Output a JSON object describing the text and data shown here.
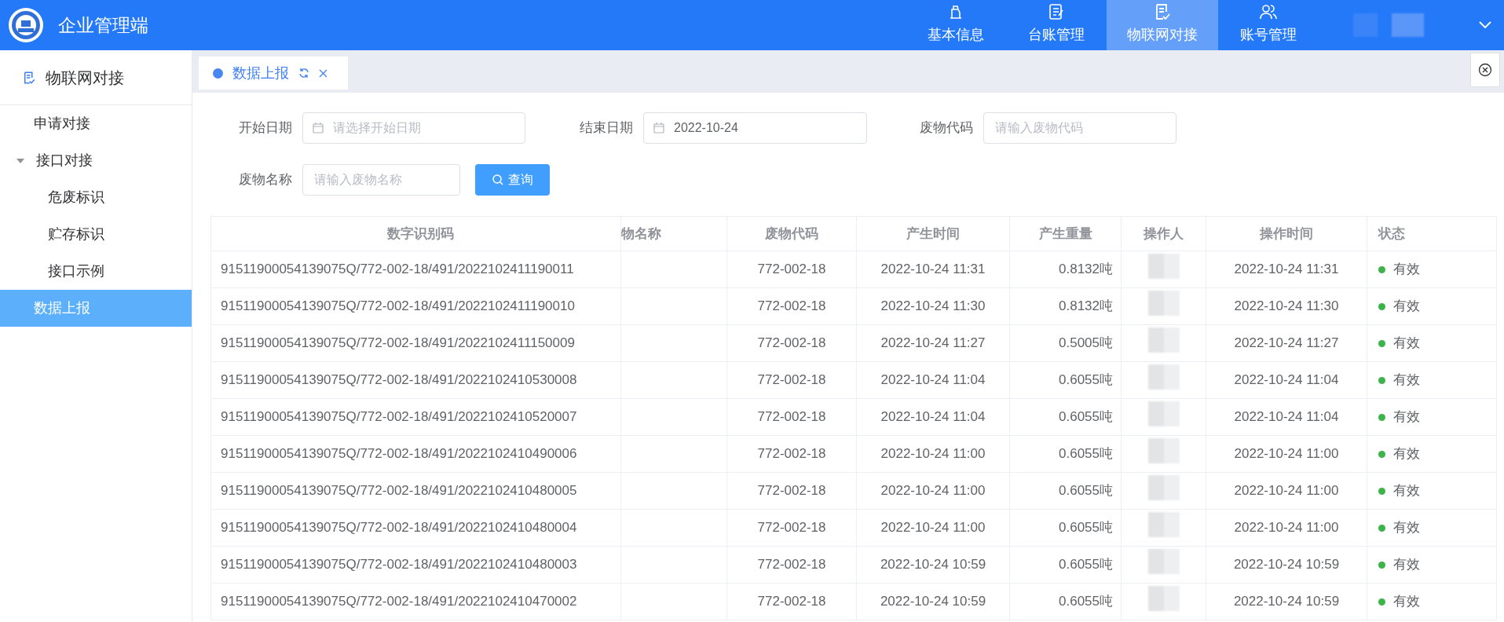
{
  "header": {
    "title": "企业管理端",
    "nav": [
      {
        "label": "基本信息",
        "selected": false
      },
      {
        "label": "台账管理",
        "selected": false
      },
      {
        "label": "物联网对接",
        "selected": true
      },
      {
        "label": "账号管理",
        "selected": false
      }
    ]
  },
  "sidebar": {
    "title": "物联网对接",
    "items": [
      {
        "label": "申请对接",
        "selected": false
      },
      {
        "label": "接口对接",
        "selected": false,
        "expanded": true,
        "children": [
          {
            "label": "危废标识",
            "selected": false
          },
          {
            "label": "贮存标识",
            "selected": false
          },
          {
            "label": "接口示例",
            "selected": false
          }
        ]
      },
      {
        "label": "数据上报",
        "selected": true
      }
    ]
  },
  "tabs": [
    {
      "label": "数据上报",
      "selected": true
    }
  ],
  "filters": [
    {
      "label": "开始日期",
      "kind": "date",
      "placeholder": "请选择开始日期"
    },
    {
      "label": "结束日期",
      "kind": "date",
      "value": "2022-10-24"
    },
    {
      "label": "废物代码",
      "kind": "text",
      "placeholder": "请输入废物代码"
    },
    {
      "label": "废物名称",
      "kind": "text",
      "placeholder": "请输入废物名称"
    }
  ],
  "search_button": "查询",
  "table": {
    "columns": [
      "数字识别码",
      "物名称",
      "废物代码",
      "产生时间",
      "产生重量",
      "操作人",
      "操作时间",
      "状态"
    ],
    "rows": [
      {
        "code": "91511900054139075Q/772-002-18/491/2022102411190011",
        "waste_code": "772-002-18",
        "time": "2022-10-24 11:31",
        "weight": "0.8132吨",
        "op_time": "2022-10-24 11:31",
        "status": "有效",
        "color": "#3cb44a"
      },
      {
        "code": "91511900054139075Q/772-002-18/491/2022102411190010",
        "waste_code": "772-002-18",
        "time": "2022-10-24 11:30",
        "weight": "0.8132吨",
        "op_time": "2022-10-24 11:30",
        "status": "有效",
        "color": "#3cb44a"
      },
      {
        "code": "91511900054139075Q/772-002-18/491/2022102411150009",
        "waste_code": "772-002-18",
        "time": "2022-10-24 11:27",
        "weight": "0.5005吨",
        "op_time": "2022-10-24 11:27",
        "status": "有效",
        "color": "#3cb44a"
      },
      {
        "code": "91511900054139075Q/772-002-18/491/2022102410530008",
        "waste_code": "772-002-18",
        "time": "2022-10-24 11:04",
        "weight": "0.6055吨",
        "op_time": "2022-10-24 11:04",
        "status": "有效",
        "color": "#3cb44a"
      },
      {
        "code": "91511900054139075Q/772-002-18/491/2022102410520007",
        "waste_code": "772-002-18",
        "time": "2022-10-24 11:04",
        "weight": "0.6055吨",
        "op_time": "2022-10-24 11:04",
        "status": "有效",
        "color": "#3cb44a"
      },
      {
        "code": "91511900054139075Q/772-002-18/491/2022102410490006",
        "waste_code": "772-002-18",
        "time": "2022-10-24 11:00",
        "weight": "0.6055吨",
        "op_time": "2022-10-24 11:00",
        "status": "有效",
        "color": "#3cb44a"
      },
      {
        "code": "91511900054139075Q/772-002-18/491/2022102410480005",
        "waste_code": "772-002-18",
        "time": "2022-10-24 11:00",
        "weight": "0.6055吨",
        "op_time": "2022-10-24 11:00",
        "status": "有效",
        "color": "#3cb44a"
      },
      {
        "code": "91511900054139075Q/772-002-18/491/2022102410480004",
        "waste_code": "772-002-18",
        "time": "2022-10-24 11:00",
        "weight": "0.6055吨",
        "op_time": "2022-10-24 11:00",
        "status": "有效",
        "color": "#3cb44a"
      },
      {
        "code": "91511900054139075Q/772-002-18/491/2022102410480003",
        "waste_code": "772-002-18",
        "time": "2022-10-24 10:59",
        "weight": "0.6055吨",
        "op_time": "2022-10-24 10:59",
        "status": "有效",
        "color": "#3cb44a"
      },
      {
        "code": "91511900054139075Q/772-002-18/491/2022102410470002",
        "waste_code": "772-002-18",
        "time": "2022-10-24 10:59",
        "weight": "0.6055吨",
        "op_time": "2022-10-24 10:59",
        "status": "有效",
        "color": "#3cb44a"
      }
    ]
  }
}
